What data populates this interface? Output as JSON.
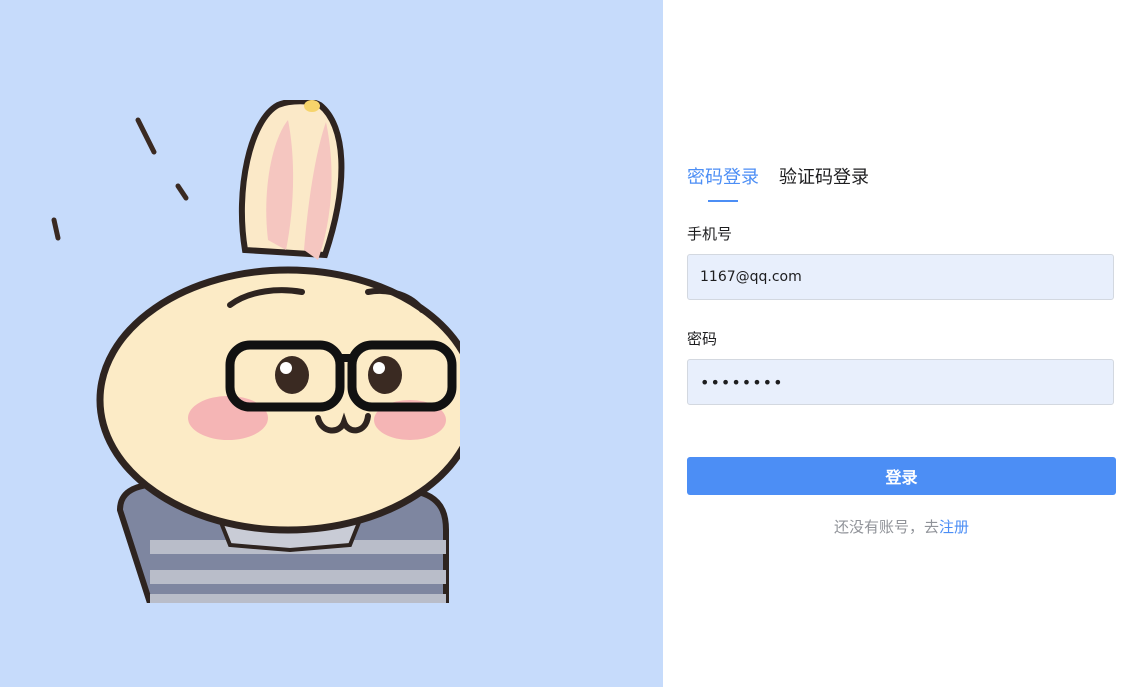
{
  "tabs": [
    {
      "label": "密码登录",
      "active": true
    },
    {
      "label": "验证码登录",
      "active": false
    }
  ],
  "form": {
    "phone_label": "手机号",
    "phone_value": "1167@qq.com",
    "password_label": "密码",
    "password_value": "••••••••"
  },
  "login_button": "登录",
  "register": {
    "prompt": "还没有账号，去",
    "link": "注册"
  },
  "colors": {
    "accent": "#4c8ef5",
    "left_bg": "#c6dbfb",
    "input_bg": "#e8effc"
  }
}
